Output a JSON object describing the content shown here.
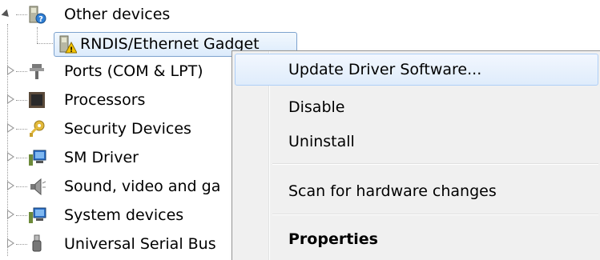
{
  "tree": {
    "items": [
      {
        "label": "Other devices",
        "icon": "unknown-device-icon",
        "expanded": true
      },
      {
        "label": "RNDIS/Ethernet Gadget",
        "icon": "warning-device-icon",
        "child": true,
        "selected": true
      },
      {
        "label": "Ports (COM & LPT)",
        "icon": "port-icon"
      },
      {
        "label": "Processors",
        "icon": "processor-icon"
      },
      {
        "label": "Security Devices",
        "icon": "security-key-icon"
      },
      {
        "label": "SM Driver",
        "icon": "computer-icon"
      },
      {
        "label": "Sound, video and ga",
        "icon": "speaker-icon"
      },
      {
        "label": "System devices",
        "icon": "computer-icon"
      },
      {
        "label": "Universal Serial Bus",
        "icon": "usb-icon"
      }
    ]
  },
  "context_menu": {
    "items": [
      {
        "label": "Update Driver Software...",
        "highlighted": true
      },
      {
        "label": "Disable"
      },
      {
        "label": "Uninstall"
      },
      {
        "label": "Scan for hardware changes"
      },
      {
        "label": "Properties",
        "bold": true
      }
    ]
  },
  "colors": {
    "selection_border": "#7da2ce",
    "menu_background": "#f0f0f0",
    "menu_highlight_border": "#aecff7",
    "warning": "#f5c400"
  }
}
